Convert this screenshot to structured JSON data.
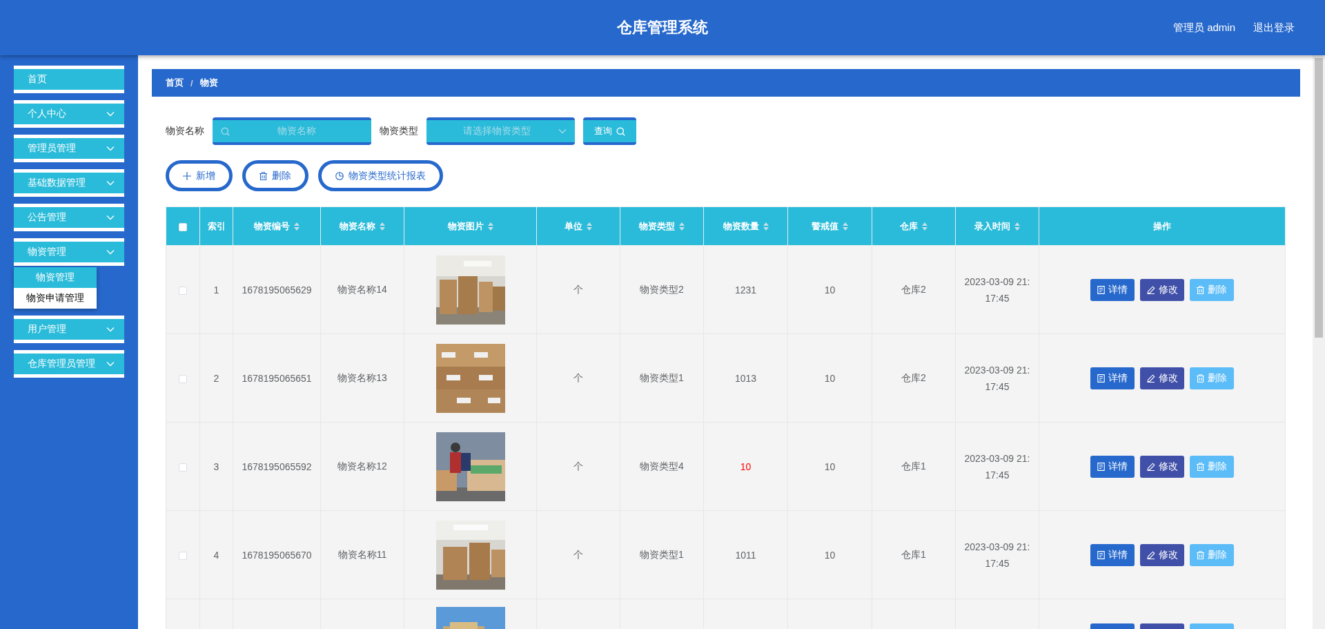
{
  "header": {
    "title": "仓库管理系统",
    "user": "管理员 admin",
    "logout": "退出登录"
  },
  "sidebar": {
    "items": [
      {
        "label": "首页",
        "kind": "link"
      },
      {
        "label": "个人中心",
        "kind": "menu"
      },
      {
        "label": "管理员管理",
        "kind": "menu"
      },
      {
        "label": "基础数据管理",
        "kind": "menu"
      },
      {
        "label": "公告管理",
        "kind": "menu"
      },
      {
        "label": "物资管理",
        "kind": "menu",
        "children": [
          {
            "label": "物资管理",
            "selected": true
          },
          {
            "label": "物资申请管理",
            "selected": false
          }
        ]
      },
      {
        "label": "用户管理",
        "kind": "menu"
      },
      {
        "label": "仓库管理员管理",
        "kind": "menu"
      }
    ]
  },
  "breadcrumb": {
    "items": [
      "首页",
      "物资"
    ],
    "separator": "/"
  },
  "search": {
    "fields": [
      {
        "label": "物资名称",
        "kind": "input",
        "placeholder": "物资名称"
      },
      {
        "label": "物资类型",
        "kind": "select",
        "placeholder": "请选择物资类型"
      }
    ],
    "button": "查询"
  },
  "actions": [
    {
      "label": "新增",
      "kind": "add"
    },
    {
      "label": "删除",
      "kind": "delete"
    },
    {
      "label": "物资类型统计报表",
      "kind": "report"
    }
  ],
  "table": {
    "header_checked": false,
    "columns": [
      {
        "label": "索引",
        "sortable": false
      },
      {
        "label": "物资编号",
        "sortable": true
      },
      {
        "label": "物资名称",
        "sortable": true
      },
      {
        "label": "物资图片",
        "sortable": true
      },
      {
        "label": "单位",
        "sortable": true
      },
      {
        "label": "物资类型",
        "sortable": true
      },
      {
        "label": "物资数量",
        "sortable": true
      },
      {
        "label": "警戒值",
        "sortable": true
      },
      {
        "label": "仓库",
        "sortable": true
      },
      {
        "label": "录入时间",
        "sortable": true
      },
      {
        "label": "操作",
        "sortable": false
      }
    ],
    "rows": [
      {
        "kind": "full",
        "checked": false,
        "index": "1",
        "code": "1678195065629",
        "name": "物资名称14",
        "unit": "个",
        "type": "物资类型2",
        "quantity": "1231",
        "low_stock": false,
        "threshold": "10",
        "warehouse": "仓库2",
        "time": "2023-03-09 21:17:45",
        "actions": [
          {
            "label": "详情",
            "kind": "detail"
          },
          {
            "label": "修改",
            "kind": "edit"
          },
          {
            "label": "删除",
            "kind": "delete"
          }
        ]
      },
      {
        "kind": "full",
        "checked": false,
        "index": "2",
        "code": "1678195065651",
        "name": "物资名称13",
        "unit": "个",
        "type": "物资类型1",
        "quantity": "1013",
        "low_stock": false,
        "threshold": "10",
        "warehouse": "仓库2",
        "time": "2023-03-09 21:17:45",
        "actions": [
          {
            "label": "详情",
            "kind": "detail"
          },
          {
            "label": "修改",
            "kind": "edit"
          },
          {
            "label": "删除",
            "kind": "delete"
          }
        ]
      },
      {
        "kind": "full",
        "checked": false,
        "index": "3",
        "code": "1678195065592",
        "name": "物资名称12",
        "unit": "个",
        "type": "物资类型4",
        "quantity": "10",
        "low_stock": true,
        "threshold": "10",
        "warehouse": "仓库1",
        "time": "2023-03-09 21:17:45",
        "actions": [
          {
            "label": "详情",
            "kind": "detail"
          },
          {
            "label": "修改",
            "kind": "edit"
          },
          {
            "label": "删除",
            "kind": "delete"
          }
        ]
      },
      {
        "kind": "full",
        "checked": false,
        "index": "4",
        "code": "1678195065670",
        "name": "物资名称11",
        "unit": "个",
        "type": "物资类型1",
        "quantity": "1011",
        "low_stock": false,
        "threshold": "10",
        "warehouse": "仓库1",
        "time": "2023-03-09 21:17:45",
        "actions": [
          {
            "label": "详情",
            "kind": "detail"
          },
          {
            "label": "修改",
            "kind": "edit"
          },
          {
            "label": "删除",
            "kind": "delete"
          }
        ]
      },
      {
        "kind": "partial",
        "actions": [
          {
            "kind": "detail"
          },
          {
            "kind": "edit"
          },
          {
            "kind": "delete"
          }
        ]
      }
    ]
  }
}
